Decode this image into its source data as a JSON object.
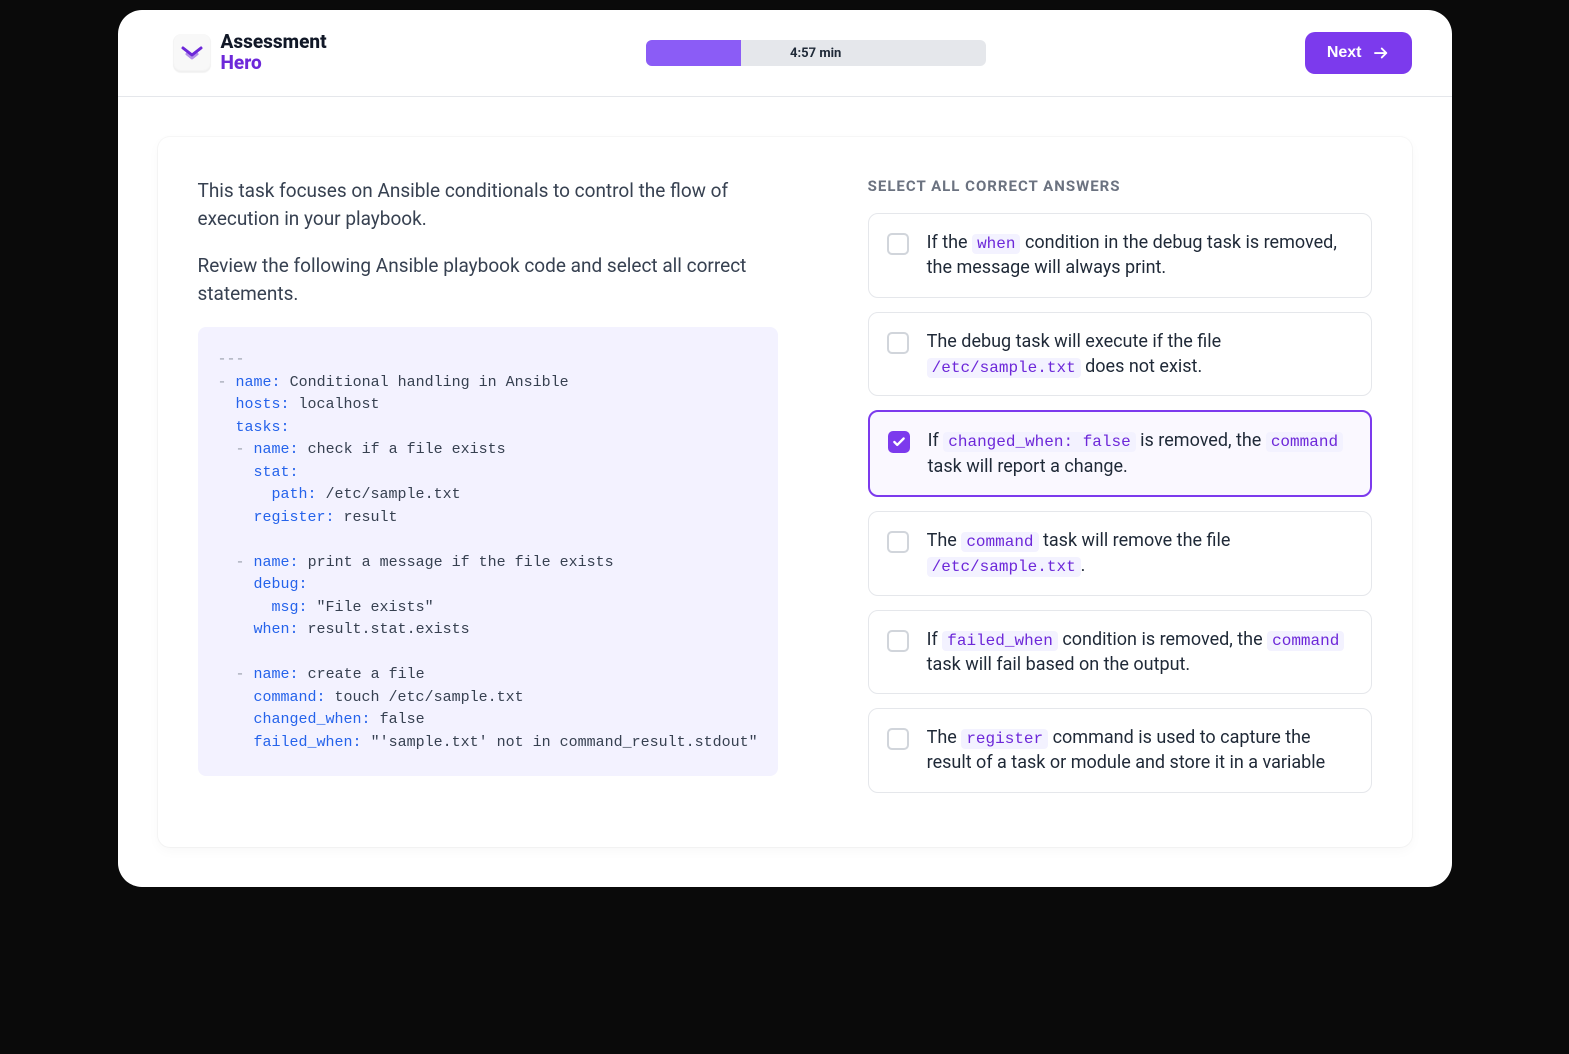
{
  "header": {
    "logo_line1": "Assessment",
    "logo_line2": "Hero",
    "timer": "4:57 min",
    "next_label": "Next"
  },
  "question": {
    "intro1": "This task focuses on Ansible conditionals to control the flow of execution in your playbook.",
    "intro2": "Review the following Ansible playbook code and select all correct statements.",
    "code": {
      "l1": "---",
      "l2_dash": "-",
      "l2_key": "name:",
      "l2_val": "Conditional handling in Ansible",
      "l3_key": "hosts:",
      "l3_val": "localhost",
      "l4_key": "tasks:",
      "l5_dash": "-",
      "l5_key": "name:",
      "l5_val": "check if a file exists",
      "l6_key": "stat:",
      "l7_key": "path:",
      "l7_val": "/etc/sample.txt",
      "l8_key": "register:",
      "l8_val": "result",
      "l9_dash": "-",
      "l9_key": "name:",
      "l9_val": "print a message if the file exists",
      "l10_key": "debug:",
      "l11_key": "msg:",
      "l11_val": "\"File exists\"",
      "l12_key": "when:",
      "l12_val": "result.stat.exists",
      "l13_dash": "-",
      "l13_key": "name:",
      "l13_val": "create a file",
      "l14_key": "command:",
      "l14_val": "touch /etc/sample.txt",
      "l15_key": "changed_when:",
      "l15_val": "false",
      "l16_key": "failed_when:",
      "l16_val": "\"'sample.txt' not in command_result.stdout\""
    }
  },
  "answers": {
    "title": "SELECT ALL CORRECT ANSWERS",
    "options": [
      {
        "checked": false,
        "segments": [
          {
            "t": "text",
            "v": "If the "
          },
          {
            "t": "code",
            "v": "when"
          },
          {
            "t": "text",
            "v": " condition in the debug task is removed, the message will always print."
          }
        ]
      },
      {
        "checked": false,
        "segments": [
          {
            "t": "text",
            "v": "The debug task will execute if the file "
          },
          {
            "t": "code",
            "v": "/etc/sample.txt"
          },
          {
            "t": "text",
            "v": " does not exist."
          }
        ]
      },
      {
        "checked": true,
        "segments": [
          {
            "t": "text",
            "v": "If "
          },
          {
            "t": "code",
            "v": "changed_when: false"
          },
          {
            "t": "text",
            "v": " is removed, the "
          },
          {
            "t": "code",
            "v": "command"
          },
          {
            "t": "text",
            "v": " task will report a change."
          }
        ]
      },
      {
        "checked": false,
        "segments": [
          {
            "t": "text",
            "v": "The "
          },
          {
            "t": "code",
            "v": "command"
          },
          {
            "t": "text",
            "v": " task will remove the file "
          },
          {
            "t": "code",
            "v": "/etc/sample.txt"
          },
          {
            "t": "text",
            "v": "."
          }
        ]
      },
      {
        "checked": false,
        "segments": [
          {
            "t": "text",
            "v": "If "
          },
          {
            "t": "code",
            "v": "failed_when"
          },
          {
            "t": "text",
            "v": " condition is removed, the "
          },
          {
            "t": "code",
            "v": "command"
          },
          {
            "t": "text",
            "v": " task will fail based on the output."
          }
        ]
      },
      {
        "checked": false,
        "segments": [
          {
            "t": "text",
            "v": "The "
          },
          {
            "t": "code",
            "v": "register"
          },
          {
            "t": "text",
            "v": " command is used to capture the result of a task or module and store it in a variable"
          }
        ]
      }
    ]
  }
}
